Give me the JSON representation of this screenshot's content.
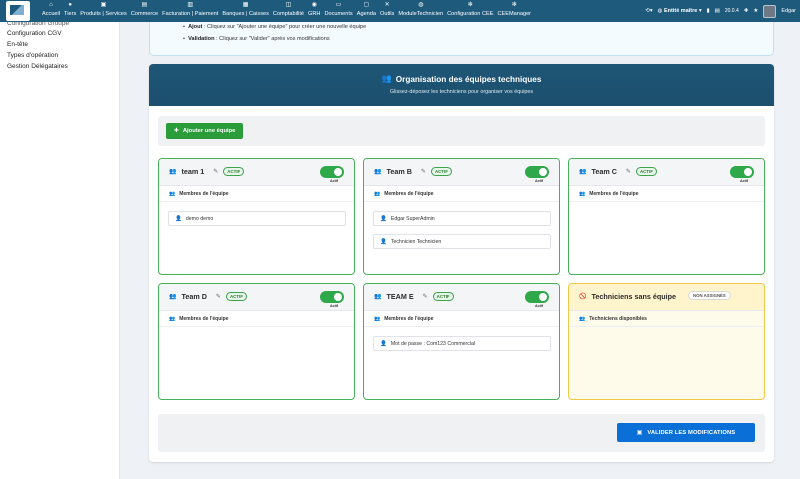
{
  "topnav": {
    "items": [
      {
        "icon": "home-icon",
        "glyph": "⌂",
        "label": "Accueil"
      },
      {
        "icon": "tiers-icon",
        "glyph": "●",
        "label": "Tiers"
      },
      {
        "icon": "cube-icon",
        "glyph": "▣",
        "label": "Produits | Services"
      },
      {
        "icon": "commerce-icon",
        "glyph": "▤",
        "label": "Commerce"
      },
      {
        "icon": "billing-icon",
        "glyph": "▥",
        "label": "Facturation | Paiement"
      },
      {
        "icon": "bank-icon",
        "glyph": "▦",
        "label": "Banques | Caisses"
      },
      {
        "icon": "compta-icon",
        "glyph": "◫",
        "label": "Comptabilité"
      },
      {
        "icon": "grh-icon",
        "glyph": "◉",
        "label": "GRH"
      },
      {
        "icon": "documents-icon",
        "glyph": "▭",
        "label": "Documents"
      },
      {
        "icon": "agenda-icon",
        "glyph": "▢",
        "label": "Agenda"
      },
      {
        "icon": "tools-icon",
        "glyph": "✕",
        "label": "Outils"
      },
      {
        "icon": "module-icon",
        "glyph": "◍",
        "label": "ModuleTechnicien"
      },
      {
        "icon": "config-icon",
        "glyph": "✻",
        "label": "Configuration CEE"
      },
      {
        "icon": "cee-icon",
        "glyph": "✻",
        "label": "CEEManager"
      }
    ],
    "entity": "Entité maître",
    "version": "20.0.4",
    "user": "Edgar"
  },
  "sidebar": {
    "items": [
      "Configuration Groupe",
      "Configuration CGV",
      "En-tête",
      "Types d'opération",
      "Gestion Délégataires"
    ]
  },
  "info": {
    "line1_bold": "Ajout",
    "line1_text": " : Cliquez sur \"Ajouter une équipe\" pour créer une nouvelle équipe",
    "line2_bold": "Validation",
    "line2_text": " : Cliquez sur \"Valider\" après vos modifications"
  },
  "panel": {
    "title": "Organisation des équipes techniques",
    "subtitle": "Glissez-déposez les techniciens pour organiser vos équipes",
    "add_button": "Ajouter une équipe",
    "save_button": "VALIDER LES MODIFICATIONS"
  },
  "teams": [
    {
      "name": "team 1",
      "status": "ACTIF",
      "toggle_label": "Actif",
      "members_label": "Membres de l'équipe",
      "members": [
        "demo demo"
      ]
    },
    {
      "name": "Team B",
      "status": "ACTIF",
      "toggle_label": "Actif",
      "members_label": "Membres de l'équipe",
      "members": [
        "Edgar SuperAdmin",
        "Technicien Technicien"
      ]
    },
    {
      "name": "Team C",
      "status": "ACTIF",
      "toggle_label": "Actif",
      "members_label": "Membres de l'équipe",
      "members": []
    },
    {
      "name": "Team D",
      "status": "ACTIF",
      "toggle_label": "Actif",
      "members_label": "Membres de l'équipe",
      "members": []
    },
    {
      "name": "TEAM E",
      "status": "ACTIF",
      "toggle_label": "Actif",
      "members_label": "Membres de l'équipe",
      "members": [
        "Mot de passe : Com123 Commercial"
      ]
    }
  ],
  "unassigned": {
    "title": "Techniciens sans équipe",
    "badge": "NON ASSIGNÉS",
    "list_label": "Techniciens disponibles"
  },
  "colors": {
    "nav": "#1e5a7c",
    "active_border": "#47b05a",
    "add_button": "#2a9d3a",
    "save_button": "#0b6fd8",
    "unassigned_border": "#f0c84a"
  }
}
